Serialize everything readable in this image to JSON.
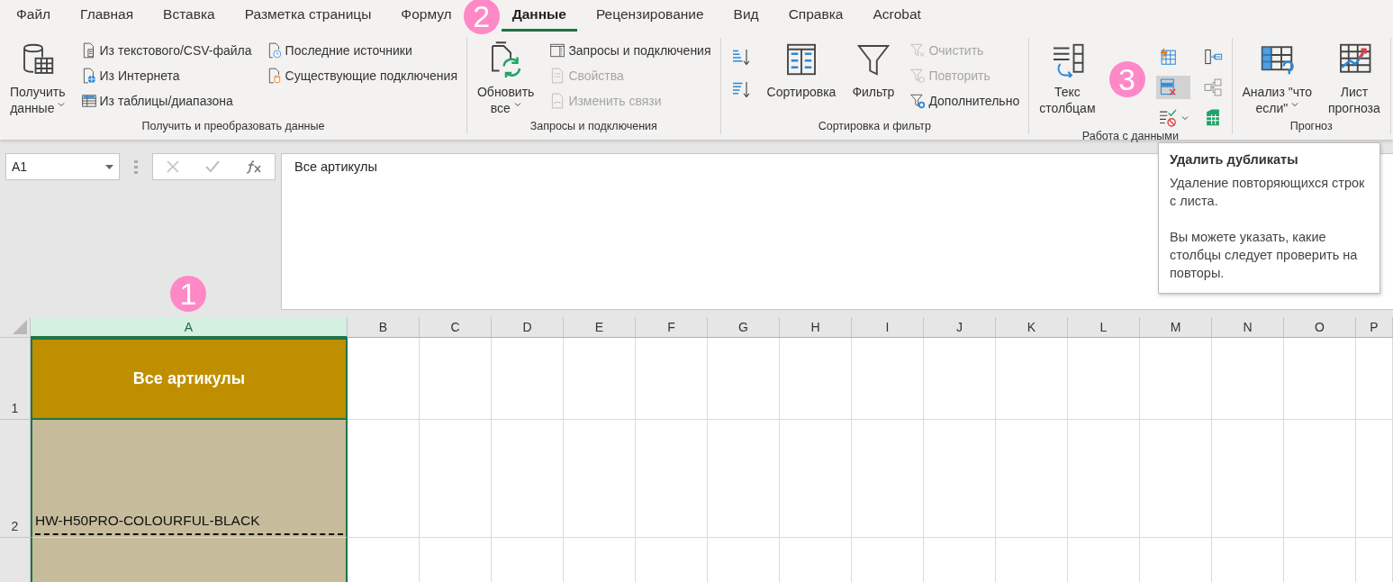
{
  "tabs": [
    {
      "label": "Файл",
      "selected": false
    },
    {
      "label": "Главная",
      "selected": false
    },
    {
      "label": "Вставка",
      "selected": false
    },
    {
      "label": "Разметка страницы",
      "selected": false
    },
    {
      "label": "Формул",
      "selected": false
    },
    {
      "label": "Данные",
      "selected": true
    },
    {
      "label": "Рецензирование",
      "selected": false
    },
    {
      "label": "Вид",
      "selected": false
    },
    {
      "label": "Справка",
      "selected": false
    },
    {
      "label": "Acrobat",
      "selected": false
    }
  ],
  "ribbon": {
    "groups": [
      {
        "label": "Получить и преобразовать данные",
        "columns": [
          [
            {
              "kind": "large",
              "lines": [
                "Получить",
                "данные"
              ],
              "dropdown": true
            }
          ],
          [
            {
              "kind": "small",
              "label": "Из текстового/CSV-файла",
              "disabled": false
            },
            {
              "kind": "small",
              "label": "Из Интернета",
              "disabled": false
            },
            {
              "kind": "small",
              "label": "Из таблицы/диапазона",
              "disabled": false
            }
          ],
          [
            {
              "kind": "small",
              "label": "Последние источники",
              "disabled": false
            },
            {
              "kind": "small",
              "label": "Существующие подключения",
              "disabled": false
            }
          ]
        ]
      },
      {
        "label": "Запросы и подключения",
        "columns": [
          [
            {
              "kind": "large",
              "lines": [
                "Обновить",
                "все"
              ],
              "dropdown": true
            }
          ],
          [
            {
              "kind": "small",
              "label": "Запросы и подключения",
              "disabled": false
            },
            {
              "kind": "small",
              "label": "Свойства",
              "disabled": true
            },
            {
              "kind": "small",
              "label": "Изменить связи",
              "disabled": true
            }
          ]
        ]
      },
      {
        "label": "Сортировка и фильтр",
        "columns": [
          [
            {
              "kind": "icon",
              "dropdown": false,
              "hovered": false
            },
            {
              "kind": "icon",
              "dropdown": false,
              "hovered": false
            }
          ],
          [
            {
              "kind": "large",
              "lines": [
                "Сортировка"
              ],
              "dropdown": false
            }
          ],
          [
            {
              "kind": "large",
              "lines": [
                "Фильтр"
              ],
              "dropdown": false
            }
          ],
          [
            {
              "kind": "small",
              "label": "Очистить",
              "disabled": true
            },
            {
              "kind": "small",
              "label": "Повторить",
              "disabled": true
            },
            {
              "kind": "small",
              "label": "Дополнительно",
              "disabled": false
            }
          ]
        ]
      },
      {
        "label": "Работа с данными",
        "columns": [
          [
            {
              "kind": "large",
              "lines": [
                "Текс",
                "столбцам"
              ],
              "dropdown": false
            }
          ],
          [
            {
              "kind": "icon",
              "dropdown": false,
              "hovered": false
            },
            {
              "kind": "icon",
              "dropdown": false,
              "hovered": true
            },
            {
              "kind": "icon",
              "dropdown": true,
              "hovered": false
            }
          ],
          [
            {
              "kind": "icon",
              "dropdown": false,
              "hovered": false
            },
            {
              "kind": "icon",
              "dropdown": false,
              "hovered": false
            },
            {
              "kind": "icon",
              "dropdown": false,
              "hovered": false
            }
          ]
        ]
      },
      {
        "label": "Прогноз",
        "columns": [
          [
            {
              "kind": "large",
              "lines": [
                "Анализ \"что",
                "если\""
              ],
              "dropdown": true
            }
          ],
          [
            {
              "kind": "large",
              "lines": [
                "Лист",
                "прогноза"
              ],
              "dropdown": false
            }
          ]
        ]
      }
    ]
  },
  "formula_bar": {
    "name_box": "A1",
    "formula": "Все артикулы"
  },
  "tooltip": {
    "title": "Удалить дубликаты",
    "paragraphs": [
      "Удаление повторяющихся строк с листа.",
      "Вы можете указать, какие столбцы следует проверить на повторы."
    ]
  },
  "sheet": {
    "columns": [
      {
        "label": "A",
        "selected": true
      },
      {
        "label": "B",
        "selected": false
      },
      {
        "label": "C",
        "selected": false
      },
      {
        "label": "D",
        "selected": false
      },
      {
        "label": "E",
        "selected": false
      },
      {
        "label": "F",
        "selected": false
      },
      {
        "label": "G",
        "selected": false
      },
      {
        "label": "H",
        "selected": false
      },
      {
        "label": "I",
        "selected": false
      },
      {
        "label": "J",
        "selected": false
      },
      {
        "label": "K",
        "selected": false
      },
      {
        "label": "L",
        "selected": false
      },
      {
        "label": "M",
        "selected": false
      },
      {
        "label": "N",
        "selected": false
      },
      {
        "label": "O",
        "selected": false
      },
      {
        "label": "P",
        "selected": false
      }
    ],
    "rows": [
      {
        "number": "1",
        "cells": [
          {
            "kind": "header",
            "text": "Все артикулы",
            "active": true
          }
        ]
      },
      {
        "number": "2",
        "cells": [
          {
            "kind": "value",
            "text": "HW-H50PRO-COLOURFUL-BLACK",
            "active": false
          }
        ]
      }
    ]
  },
  "badges": [
    "1",
    "2",
    "3"
  ]
}
